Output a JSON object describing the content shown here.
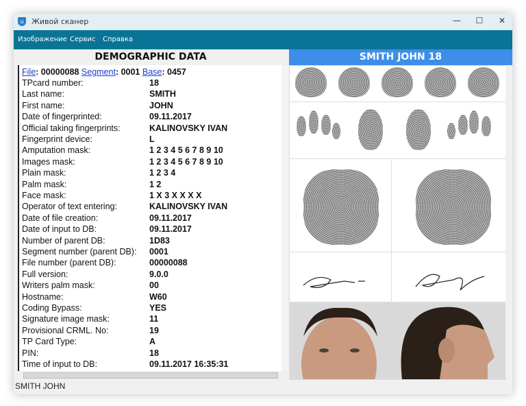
{
  "window": {
    "title": "Живой сканер",
    "minimize": "—",
    "maximize": "☐",
    "close": "✕"
  },
  "menu": [
    "Изображение",
    "Сервис",
    "Справка"
  ],
  "left": {
    "header": "DEMOGRAPHIC DATA",
    "file_link": "File",
    "file_value": "00000088",
    "segment_link": "Segment",
    "segment_value": "0001",
    "base_link": "Base",
    "base_value": "0457",
    "rows": [
      {
        "label": "TPcard number:",
        "value": "18"
      },
      {
        "label": "Last name:",
        "value": "SMITH"
      },
      {
        "label": "First name:",
        "value": "JOHN"
      },
      {
        "label": "Date of fingerprinted:",
        "value": "09.11.2017"
      },
      {
        "label": "Official taking fingerprints:",
        "value": "KALINOVSKY IVAN"
      },
      {
        "label": "Fingerprint device:",
        "value": "L"
      },
      {
        "label": "Amputation mask:",
        "value": "1 2 3 4 5 6 7 8 9 10"
      },
      {
        "label": "Images mask:",
        "value": "1 2 3 4 5 6 7 8 9 10"
      },
      {
        "label": "Plain mask:",
        "value": "1 2 3 4"
      },
      {
        "label": "Palm mask:",
        "value": "1 2"
      },
      {
        "label": "Face mask:",
        "value": "1 X 3 X X X X"
      },
      {
        "label": "Operator of text entering:",
        "value": "KALINOVSKY IVAN"
      },
      {
        "label": "Date of file creation:",
        "value": "09.11.2017"
      },
      {
        "label": "Date of input to DB:",
        "value": "09.11.2017"
      },
      {
        "label": "Number of parent DB:",
        "value": "1D83"
      },
      {
        "label": "Segment number (parent DB):",
        "value": "0001"
      },
      {
        "label": "File number (parent DB):",
        "value": "00000088"
      },
      {
        "label": "Full version:",
        "value": "9.0.0"
      },
      {
        "label": "Writers palm mask:",
        "value": "00"
      },
      {
        "label": "Hostname:",
        "value": "W60"
      },
      {
        "label": "Coding Bypass:",
        "value": "YES"
      },
      {
        "label": "Signature image mask:",
        "value": "11"
      },
      {
        "label": "Provisional CRML. No:",
        "value": "19"
      },
      {
        "label": "TP Card Type:",
        "value": "A"
      },
      {
        "label": "PIN:",
        "value": "18"
      },
      {
        "label": "Time of input to DB:",
        "value": "09.11.2017 16:35:31"
      }
    ]
  },
  "right": {
    "header": "SMITH JOHN  18"
  },
  "status": "SMITH JOHN"
}
